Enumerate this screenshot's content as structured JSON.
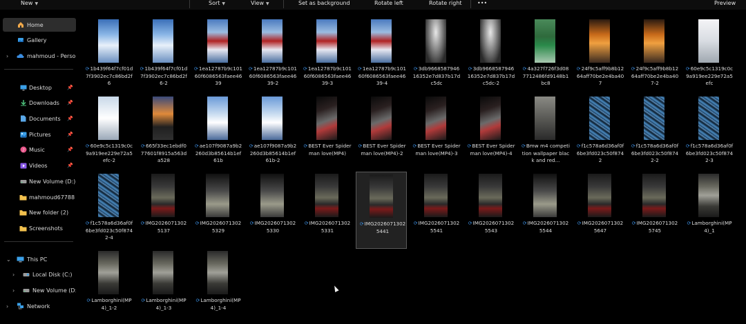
{
  "toolbar": {
    "new": "New",
    "sort": "Sort",
    "view": "View",
    "set_background": "Set as background",
    "rotate_left": "Rotate left",
    "rotate_right": "Rotate right",
    "more": "•••",
    "preview": "Preview"
  },
  "sidebar": {
    "home": "Home",
    "gallery": "Gallery",
    "onedrive": "mahmoud - Persona",
    "desktop": "Desktop",
    "downloads": "Downloads",
    "documents": "Documents",
    "pictures": "Pictures",
    "music": "Music",
    "videos": "Videos",
    "new_volume_d": "New Volume (D:)",
    "mahmoud67788": "mahmoud67788",
    "new_folder_2": "New folder (2)",
    "screenshots": "Screenshots",
    "this_pc": "This PC",
    "local_disk": "Local Disk (C:)",
    "new_volume_d2": "New Volume (D:)",
    "network": "Network"
  },
  "files": [
    {
      "name": "1b439f64f7cf01d7f3902ec7c86bd2f6",
      "thumb": "snow"
    },
    {
      "name": "1b439f64f7cf01d7f3902ec7c86bd2f6-2",
      "thumb": "snow"
    },
    {
      "name": "1ea12787b9c10160f6086563faee4639",
      "thumb": "redcar"
    },
    {
      "name": "1ea12787b9c10160f6086563faee4639-2",
      "thumb": "redcar"
    },
    {
      "name": "1ea12787b9c10160f6086563faee4639-3",
      "thumb": "redcar"
    },
    {
      "name": "1ea12787b9c10160f6086563faee4639-4",
      "thumb": "redcar"
    },
    {
      "name": "3db966858794616352e7d837b17dc5dc",
      "thumb": "garage"
    },
    {
      "name": "3db966858794616352e7d837b17dc5dc-2",
      "thumb": "garage"
    },
    {
      "name": "4a327f726f3d087712486fd9148b1bc8",
      "thumb": "green"
    },
    {
      "name": "24f9c5aff9b8b1264aff70be2e4ba407",
      "thumb": "sunset"
    },
    {
      "name": "24f9c5aff9b8b1264aff70be2e4ba407-2",
      "thumb": "sunset"
    },
    {
      "name": "60e9c5c1319c0c9a919ee229e72a5efc",
      "thumb": "white"
    },
    {
      "name": "60e9c5c1319c0c9a919ee229e72a5efc-2",
      "thumb": "snowcar"
    },
    {
      "name": "665f33ec1ebdf077601f8915a563da528",
      "thumb": "dusk"
    },
    {
      "name": "ae107f9087a9b2260d3b85614b1ef61b",
      "thumb": "road"
    },
    {
      "name": "ae107f9087a9b2260d3b85614b1ef61b-2",
      "thumb": "road"
    },
    {
      "name": "BEST Ever Spiderman love(MP4)",
      "thumb": "spider"
    },
    {
      "name": "BEST Ever Spiderman love(MP4)-2",
      "thumb": "spider"
    },
    {
      "name": "BEST Ever Spiderman love(MP4)-3",
      "thumb": "spider"
    },
    {
      "name": "BEST Ever Spiderman love(MP4)-4",
      "thumb": "spider"
    },
    {
      "name": "Bmw m4 competition wallpaper black and red...",
      "thumb": "bmw"
    },
    {
      "name": "f1c578a6d36af0f6be3fd023c50f8742",
      "thumb": "glass"
    },
    {
      "name": "f1c578a6d36af0f6be3fd023c50f8742-2",
      "thumb": "glass"
    },
    {
      "name": "f1c578a6d36af0f6be3fd023c50f8742-3",
      "thumb": "glass"
    },
    {
      "name": "f1c578a6d36af0f6be3fd023c50f8742-4",
      "thumb": "glass"
    },
    {
      "name": "IMG20260713025137",
      "thumb": "screen"
    },
    {
      "name": "IMG20260713025329",
      "thumb": "screen2"
    },
    {
      "name": "IMG20260713025330",
      "thumb": "screen2"
    },
    {
      "name": "IMG20260713025331",
      "thumb": "screen"
    },
    {
      "name": "IMG20260713025441",
      "thumb": "screen",
      "selected": true
    },
    {
      "name": "IMG20260713025541",
      "thumb": "screen"
    },
    {
      "name": "IMG20260713025543",
      "thumb": "screen"
    },
    {
      "name": "IMG20260713025544",
      "thumb": "screen2"
    },
    {
      "name": "IMG20260713025647",
      "thumb": "screen"
    },
    {
      "name": "IMG20260713025745",
      "thumb": "screen"
    },
    {
      "name": "Lamborghini(MP4)_1",
      "thumb": "lambo"
    },
    {
      "name": "Lamborghini(MP4)_1-2",
      "thumb": "lambo"
    },
    {
      "name": "Lamborghini(MP4)_1-3",
      "thumb": "lambo"
    },
    {
      "name": "Lamborghini(MP4)_1-4",
      "thumb": "lambo"
    }
  ]
}
